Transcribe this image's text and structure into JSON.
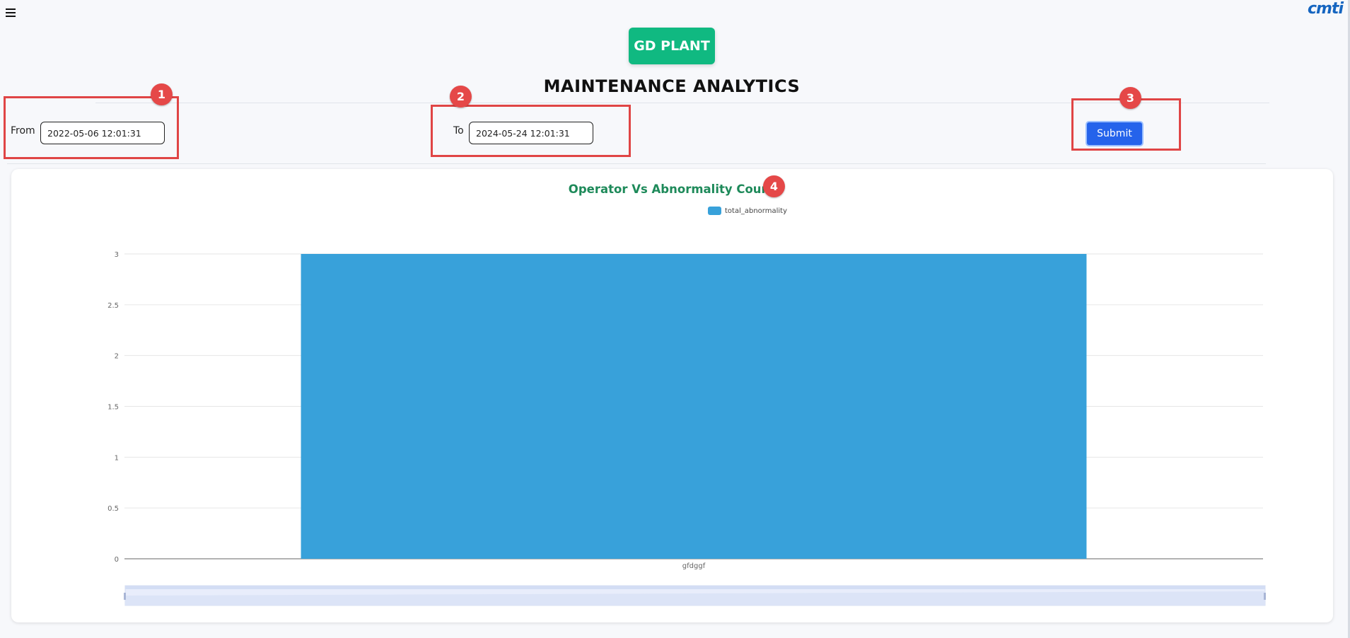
{
  "header": {
    "plant_name": "GD PLANT",
    "page_title": "MAINTENANCE ANALYTICS"
  },
  "filters": {
    "from_label": "From",
    "from_value": "2022-05-06 12:01:31",
    "to_label": "To",
    "to_value": "2024-05-24 12:01:31",
    "submit_label": "Submit"
  },
  "annotations": [
    "1",
    "2",
    "3",
    "4"
  ],
  "icons": {
    "menu": "hamburger-menu-icon",
    "brand": "brand-logo"
  },
  "colors": {
    "plant_badge": "#10b981",
    "submit": "#2563eb",
    "bar": "#38a1da",
    "chart_title": "#1e8a5a",
    "annotation": "#e04545"
  },
  "chart_data": {
    "type": "bar",
    "title": "Operator Vs Abnormality Count",
    "categories": [
      "gfdggf"
    ],
    "series": [
      {
        "name": "total_abnormality",
        "values": [
          3
        ]
      }
    ],
    "ylim": [
      0,
      3
    ],
    "yticks": [
      "0",
      "0.5",
      "1",
      "1.5",
      "2",
      "2.5",
      "3"
    ],
    "legend_position": "top-center",
    "grid": true,
    "data_zoom_slider": true
  }
}
